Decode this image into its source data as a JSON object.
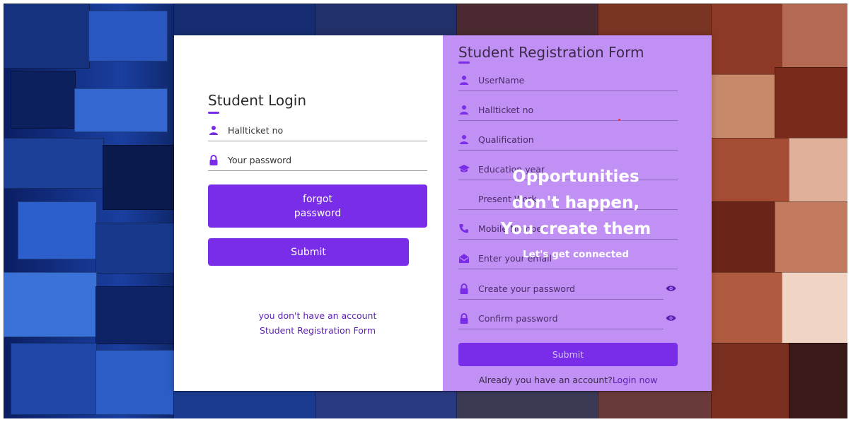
{
  "login": {
    "title": "Student Login",
    "hallticket_placeholder": "Hallticket no",
    "password_placeholder": "Your password",
    "forgot_line1": "forgot",
    "forgot_line2": "password",
    "submit_label": "Submit",
    "no_account_text": "you don't have an account",
    "register_link": "Student Registration Form"
  },
  "register": {
    "title": "Student Registration Form",
    "fields": [
      {
        "label": "UserName",
        "icon": "user-icon"
      },
      {
        "label": "Hallticket no",
        "icon": "user-icon"
      },
      {
        "label": "Qualification",
        "icon": "user-icon"
      },
      {
        "label": "Education year",
        "icon": "graduation-cap-icon"
      },
      {
        "label": "Present Work",
        "icon": ""
      },
      {
        "label": "Mobile Number",
        "icon": "phone-icon"
      },
      {
        "label": "Enter your email",
        "icon": "envelope-icon"
      },
      {
        "label": "Create your password",
        "icon": "lock-icon"
      },
      {
        "label": "Confirm password",
        "icon": "lock-icon"
      }
    ],
    "submit_label": "Submit",
    "already_text": "Already you have an account?",
    "login_now": "Login now"
  },
  "overlay": {
    "line1": "Opportunities",
    "line2": "don't happen,",
    "line3": "You create them",
    "sub": "Let's get connected"
  },
  "colors": {
    "accent": "#7a2de8",
    "register_bg": "#c190f4",
    "link": "#5a1fb3"
  }
}
